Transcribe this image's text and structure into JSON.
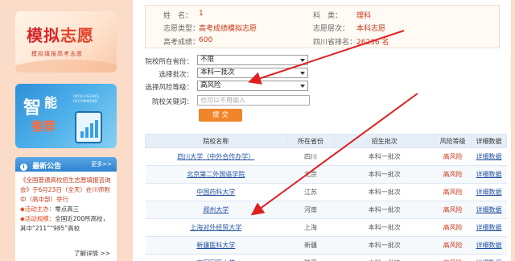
{
  "sidebar": {
    "banner1": {
      "title_a": "模拟",
      "title_b": "志愿",
      "subtitle": "模拟填报高考志愿"
    },
    "banner2": {
      "w1": "智",
      "w2": "能",
      "w3": "推荐",
      "en": "INTELLIGENCE RECOMMEND"
    },
    "notice": {
      "header": "最新公告",
      "more": "更多>>",
      "line1": "《全国普通高校招生志愿填报咨询会》于6月23日（全天）在川师附中（高中部）举行",
      "host_label": "◆活动主办：",
      "host_value": "零点高三",
      "scale_label": "◆活动规模：",
      "scale_value": "全国近200所高校，其中“211”“985”高校",
      "detail": "了解详情 >>"
    }
  },
  "info": {
    "name_label": "姓　名：",
    "name_value": "1",
    "subject_label": "科　类：",
    "subject_value": "理科",
    "type_label": "志愿类型：",
    "type_value": "高考成绩模拟志愿",
    "level_label": "志愿层次：",
    "level_value": "本科志愿",
    "score_label": "高考成绩：",
    "score_value": "600",
    "rank_label": "四川省排名：",
    "rank_value": "26236 名"
  },
  "form": {
    "province_label": "院校所在省份：",
    "province_value": "不限",
    "batch_label": "选择批次：",
    "batch_value": "本科一批次",
    "risk_label": "选择风险等级：",
    "risk_value": "高风险",
    "keyword_label": "院校关键词：",
    "keyword_placeholder": "也可以不用输入",
    "submit_label": "提 交"
  },
  "table": {
    "headers": [
      "院校名称",
      "所在省份",
      "招生批次",
      "风险等级",
      "详细数据"
    ],
    "rows": [
      {
        "name": "四川大学（中外合作办学）",
        "province": "四川",
        "batch": "本科一批次",
        "risk": "高风险",
        "detail": "详细数据"
      },
      {
        "name": "北京第二外国语学院",
        "province": "北京",
        "batch": "本科一批次",
        "risk": "高风险",
        "detail": "详细数据"
      },
      {
        "name": "中国药科大学",
        "province": "江苏",
        "batch": "本科一批次",
        "risk": "高风险",
        "detail": "详细数据"
      },
      {
        "name": "郑州大学",
        "province": "河南",
        "batch": "本科一批次",
        "risk": "高风险",
        "detail": "详细数据"
      },
      {
        "name": "上海对外经贸大学",
        "province": "上海",
        "batch": "本科一批次",
        "risk": "高风险",
        "detail": "详细数据"
      },
      {
        "name": "新疆医科大学",
        "province": "新疆",
        "batch": "本科一批次",
        "risk": "高风险",
        "detail": "详细数据"
      },
      {
        "name": "空军军医大学",
        "province": "陕西",
        "batch": "本科一批次",
        "risk": "高风险",
        "detail": "详细数据"
      }
    ]
  },
  "colors": {
    "accent_red": "#c8371a",
    "button_orange": "#f0852a",
    "link_blue": "#1f4fa0",
    "annotation_red": "#e02020"
  }
}
